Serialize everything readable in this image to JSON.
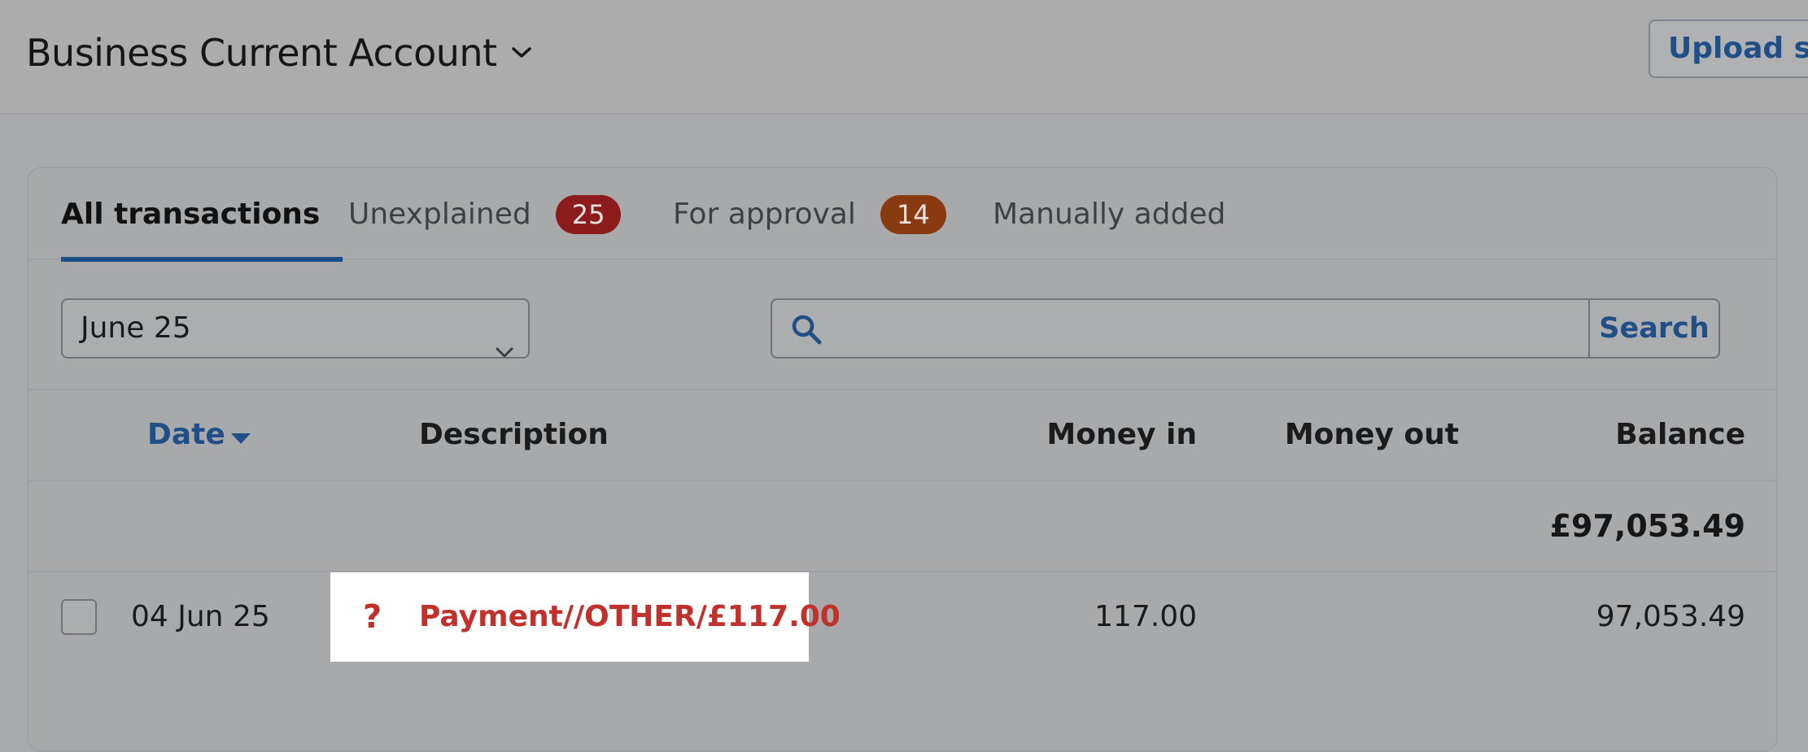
{
  "header": {
    "account_title": "Business Current Account",
    "upload_button": "Upload statement"
  },
  "tabs": [
    {
      "label": "All transactions",
      "active": true
    },
    {
      "label": "Unexplained",
      "badge": "25",
      "badge_color": "#8e1b1b"
    },
    {
      "label": "For approval",
      "badge": "14",
      "badge_color": "#8a3a10"
    },
    {
      "label": "Manually added"
    }
  ],
  "filters": {
    "month": "June 25",
    "search_placeholder": "",
    "search_button": "Search"
  },
  "table": {
    "columns": {
      "date": "Date",
      "description": "Description",
      "money_in": "Money in",
      "money_out": "Money out",
      "balance": "Balance"
    },
    "opening_balance": "£97,053.49",
    "rows": [
      {
        "date": "04 Jun 25",
        "status_icon": "?",
        "description": "Payment//OTHER/£117.00",
        "money_in": "117.00",
        "money_out": "",
        "balance": "97,053.49"
      }
    ]
  },
  "colors": {
    "accent": "#1f4f86",
    "unexplained": "#c0312b"
  }
}
